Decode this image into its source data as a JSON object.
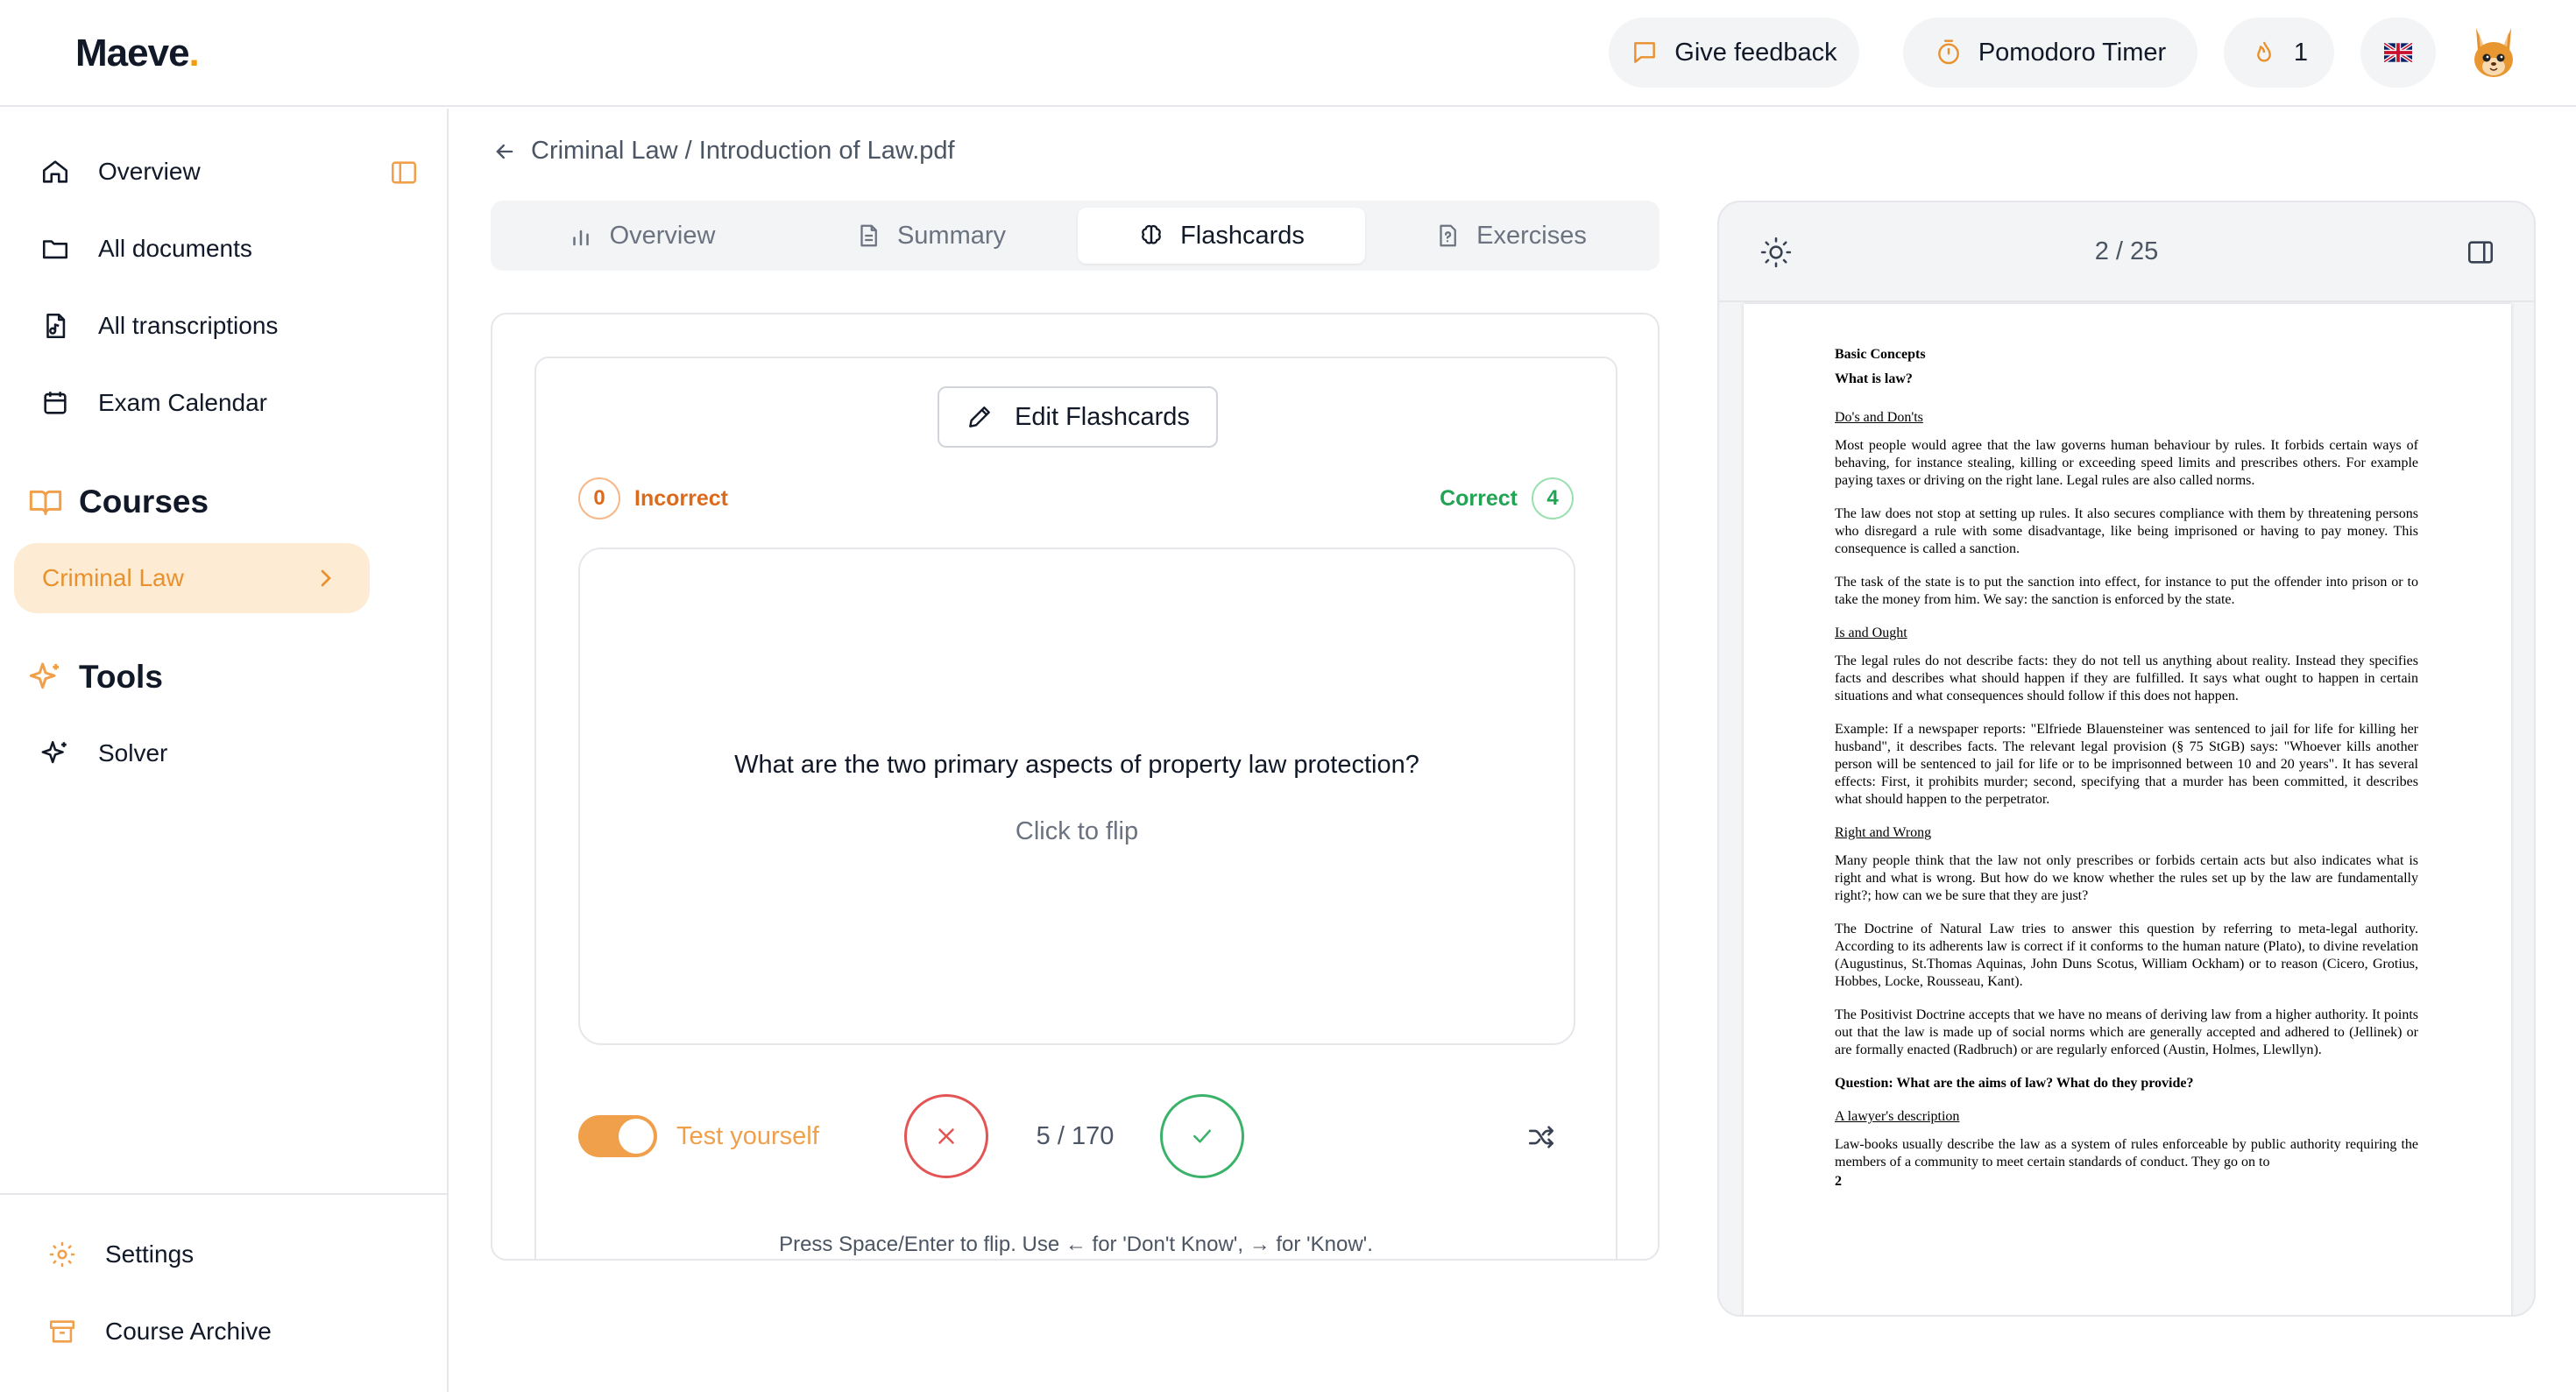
{
  "header": {
    "logo": "Maeve",
    "logo_dot": ".",
    "feedback_label": "Give feedback",
    "pomodoro_label": "Pomodoro Timer",
    "streak_count": "1",
    "language_flag": "🇬🇧"
  },
  "sidebar": {
    "nav": [
      {
        "label": "Overview",
        "icon": "home-icon"
      },
      {
        "label": "All documents",
        "icon": "folder-icon"
      },
      {
        "label": "All transcriptions",
        "icon": "audio-file-icon"
      },
      {
        "label": "Exam Calendar",
        "icon": "calendar-icon"
      }
    ],
    "courses_title": "Courses",
    "courses": [
      {
        "label": "Criminal Law",
        "active": true
      }
    ],
    "tools_title": "Tools",
    "tools": [
      {
        "label": "Solver",
        "icon": "sparkles-icon"
      }
    ],
    "bottom": [
      {
        "label": "Settings",
        "icon": "gear-icon"
      },
      {
        "label": "Course Archive",
        "icon": "archive-icon"
      }
    ]
  },
  "breadcrumb": "Criminal Law / Introduction of Law.pdf",
  "tabs": [
    {
      "label": "Overview",
      "icon": "bar-chart-icon"
    },
    {
      "label": "Summary",
      "icon": "document-icon"
    },
    {
      "label": "Flashcards",
      "icon": "brain-icon",
      "active": true
    },
    {
      "label": "Exercises",
      "icon": "question-file-icon"
    }
  ],
  "flashcards": {
    "edit_label": "Edit Flashcards",
    "incorrect_label": "Incorrect",
    "incorrect_count": "0",
    "correct_label": "Correct",
    "correct_count": "4",
    "question": "What are the two primary aspects of property law protection?",
    "flip_hint": "Click to flip",
    "test_yourself_label": "Test yourself",
    "test_yourself_on": true,
    "counter": "5 / 170",
    "keyboard_hint": "Press Space/Enter to flip. Use ← for 'Don't Know', → for 'Know'."
  },
  "viewer": {
    "page_indicator": "2 / 25",
    "page": {
      "heading1": "Basic Concepts",
      "heading2": "What is law?",
      "sections": [
        {
          "title": "Do's and Don'ts",
          "paragraphs": [
            "Most people would agree that the law governs human behaviour by rules. It forbids certain ways of behaving, for instance stealing, killing or exceeding speed limits and prescribes others. For example paying taxes or driving on the right lane. Legal rules are also called norms.",
            "The law does not stop at setting up rules. It also secures compliance with them by threatening persons who disregard a rule with some disadvantage, like being imprisoned or having to pay money. This consequence is called a sanction.",
            "The task of the state is to put the sanction into effect, for instance to put the offender into prison or to take the money from him. We say: the sanction is enforced by the state."
          ]
        },
        {
          "title": "Is and Ought",
          "paragraphs": [
            "The legal rules do not describe facts: they do not tell us anything about reality. Instead they specifies facts and describes what should happen if they are fulfilled. It says what ought to happen in certain situations and what consequences should follow if this does not happen.",
            "Example: If a newspaper reports: \"Elfriede Blauensteiner was sentenced to jail for life for killing her husband\", it describes facts. The relevant legal provision (§ 75 StGB) says: \"Whoever kills another person will be sentenced to jail for life or to be imprisonned between 10 and 20 years\". It has several effects: First, it prohibits murder; second, specifying that a murder has been committed, it describes what should happen to the perpetrator."
          ]
        },
        {
          "title": "Right and Wrong",
          "paragraphs": [
            "Many people think that the law not only prescribes or forbids certain acts but also indicates what is right and what is wrong. But how do we know whether the rules set up by the law are fundamentally right?; how can we be sure that they are just?",
            "The Doctrine of Natural Law tries to answer this question by referring to meta-legal authority. According to its adherents law is correct if it conforms to the human nature (Plato), to divine revelation (Augustinus, St.Thomas Aquinas, John Duns Scotus, William Ockham) or to reason (Cicero, Grotius, Hobbes, Locke, Rousseau, Kant).",
            "The Positivist Doctrine accepts that we have no means of deriving law from a higher authority. It points out that the law is made up of social norms which are generally accepted and adhered to (Jellinek) or are formally enacted (Radbruch) or are regularly enforced (Austin, Holmes, Llewllyn)."
          ]
        }
      ],
      "question": "Question: What are the aims of law? What do they provide?",
      "last_section_title": "A lawyer's description",
      "last_paragraph": "Law-books usually describe the law as a system of rules enforceable by public authority requiring the members of a community to meet certain standards of conduct. They go on to",
      "page_number": "2"
    }
  },
  "colors": {
    "accent": "#f0a04b",
    "active_course_bg": "#fdebd3",
    "incorrect": "#dc6a1c",
    "correct": "#21a453",
    "dont_know": "#e35454",
    "know": "#3bb26a"
  }
}
